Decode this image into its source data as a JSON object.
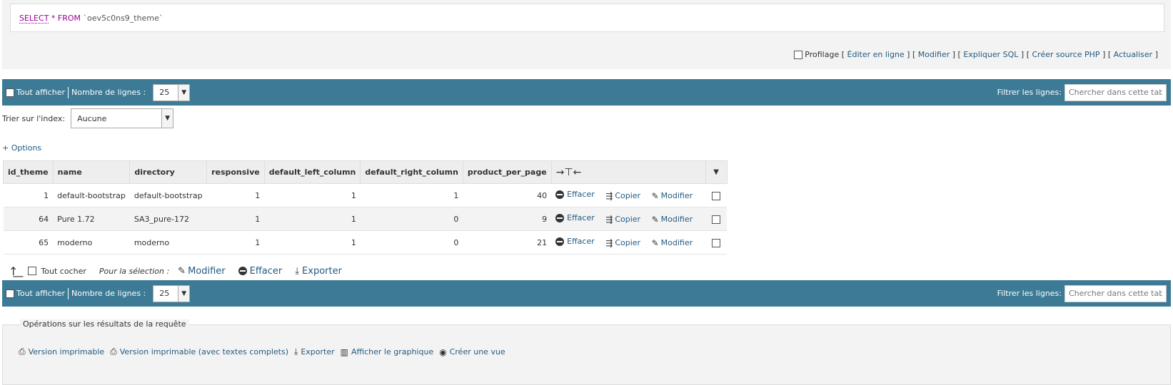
{
  "sql": {
    "keyword_select": "SELECT",
    "rest": "* FROM",
    "table": "`oev5c0ns9_theme`"
  },
  "sql_links": {
    "profiling": "Profilage",
    "edit_inline": "Éditer en ligne",
    "edit": "Modifier",
    "explain": "Expliquer SQL",
    "create_php": "Créer source PHP",
    "refresh": "Actualiser"
  },
  "navbar": {
    "show_all": "Tout afficher",
    "rows_label": "Nombre de lignes :",
    "rows_value": "25",
    "filter_label": "Filtrer les lignes:",
    "filter_placeholder": "Chercher dans cette table"
  },
  "sort": {
    "label": "Trier sur l'index:",
    "value": "Aucune"
  },
  "options_link": "+ Options",
  "table": {
    "columns": [
      "id_theme",
      "name",
      "directory",
      "responsive",
      "default_left_column",
      "default_right_column",
      "product_per_page"
    ],
    "col_toggle": "→⊤←",
    "rows": [
      {
        "id_theme": "1",
        "name": "default-bootstrap",
        "directory": "default-bootstrap",
        "responsive": "1",
        "left": "1",
        "right": "1",
        "ppp": "40"
      },
      {
        "id_theme": "64",
        "name": "Pure 1.72",
        "directory": "SA3_pure-172",
        "responsive": "1",
        "left": "1",
        "right": "0",
        "ppp": "9"
      },
      {
        "id_theme": "65",
        "name": "moderno",
        "directory": "moderno",
        "responsive": "1",
        "left": "1",
        "right": "0",
        "ppp": "21"
      }
    ],
    "actions": {
      "delete": "Effacer",
      "copy": "Copier",
      "edit": "Modifier"
    }
  },
  "selection": {
    "check_all": "Tout cocher",
    "for_selection": "Pour la sélection :",
    "edit": "Modifier",
    "delete": "Effacer",
    "export": "Exporter"
  },
  "operations": {
    "legend": "Opérations sur les résultats de la requête",
    "print": "Version imprimable",
    "print_full": "Version imprimable (avec textes complets)",
    "export": "Exporter",
    "chart": "Afficher le graphique",
    "create_view": "Créer une vue"
  }
}
